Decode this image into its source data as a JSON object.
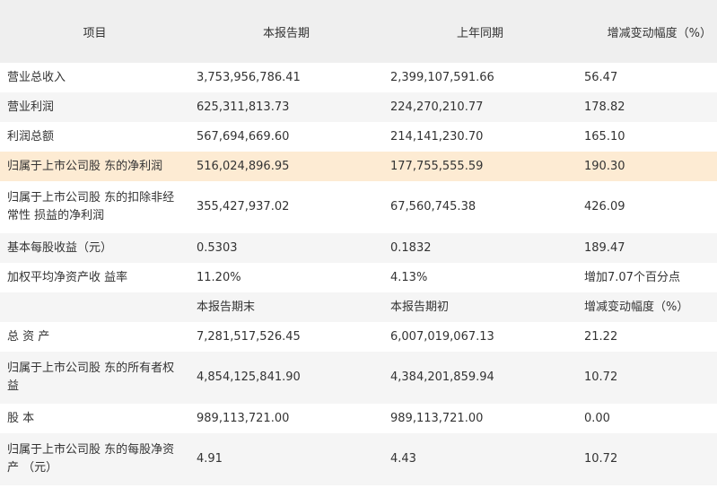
{
  "header": [
    "项目",
    "本报告期",
    "上年同期",
    "增减变动幅度（%）"
  ],
  "rows": [
    {
      "c": [
        "营业总收入",
        "3,753,956,786.41",
        "2,399,107,591.66",
        "56.47"
      ],
      "h": 1,
      "bg": "even"
    },
    {
      "c": [
        "营业利润",
        "625,311,813.73",
        "224,270,210.77",
        "178.82"
      ],
      "h": 1,
      "bg": "odd"
    },
    {
      "c": [
        "利润总额",
        "567,694,669.60",
        "214,141,230.70",
        "165.10"
      ],
      "h": 1,
      "bg": "even"
    },
    {
      "c": [
        "归属于上市公司股 东的净利润",
        "516,024,896.95",
        "177,755,555.59",
        "190.30"
      ],
      "h": 1,
      "bg": "hl"
    },
    {
      "c": [
        "归属于上市公司股 东的扣除非经常性 损益的净利润",
        "355,427,937.02",
        "67,560,745.38",
        "426.09"
      ],
      "h": 2,
      "bg": "even"
    },
    {
      "c": [
        "基本每股收益（元）",
        "0.5303",
        "0.1832",
        "189.47"
      ],
      "h": 1,
      "bg": "odd"
    },
    {
      "c": [
        "加权平均净资产收 益率",
        "11.20%",
        "4.13%",
        "增加7.07个百分点"
      ],
      "h": 1,
      "bg": "even"
    },
    {
      "c": [
        "",
        "本报告期末",
        "本报告期初",
        "增减变动幅度（%）"
      ],
      "h": 1,
      "bg": "odd"
    },
    {
      "c": [
        "总 资 产",
        "7,281,517,526.45",
        "6,007,019,067.13",
        "21.22"
      ],
      "h": 1,
      "bg": "even"
    },
    {
      "c": [
        "归属于上市公司股 东的所有者权益",
        "4,854,125,841.90",
        "4,384,201,859.94",
        "10.72"
      ],
      "h": 2,
      "bg": "odd"
    },
    {
      "c": [
        "股 本",
        "989,113,721.00",
        "989,113,721.00",
        "0.00"
      ],
      "h": 1,
      "bg": "even"
    },
    {
      "c": [
        "归属于上市公司股 东的每股净资产 （元）",
        "4.91",
        "4.43",
        "10.72"
      ],
      "h": 2,
      "bg": "odd"
    }
  ]
}
